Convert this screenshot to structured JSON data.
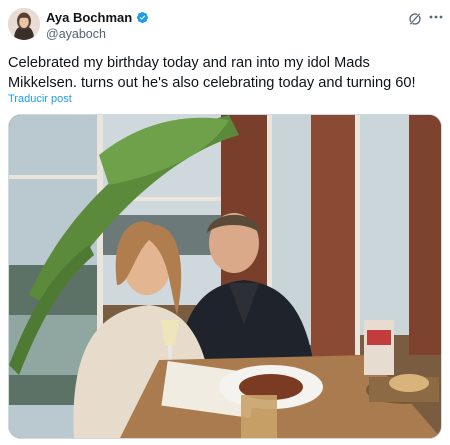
{
  "author": {
    "display_name": "Aya Bochman",
    "handle": "@ayaboch",
    "verified": true
  },
  "tweet": {
    "text": "Celebrated my birthday today and ran into my idol Mads Mikkelsen. turns out he's also celebrating today and turning 60!",
    "translate_label": "Traducir post"
  },
  "icons": {
    "verified": "verified-badge-icon",
    "grok": "grok-icon",
    "more": "more-icon"
  },
  "colors": {
    "link": "#1d9bf0",
    "verified_badge": "#1d9bf0",
    "secondary_text": "#536471"
  }
}
